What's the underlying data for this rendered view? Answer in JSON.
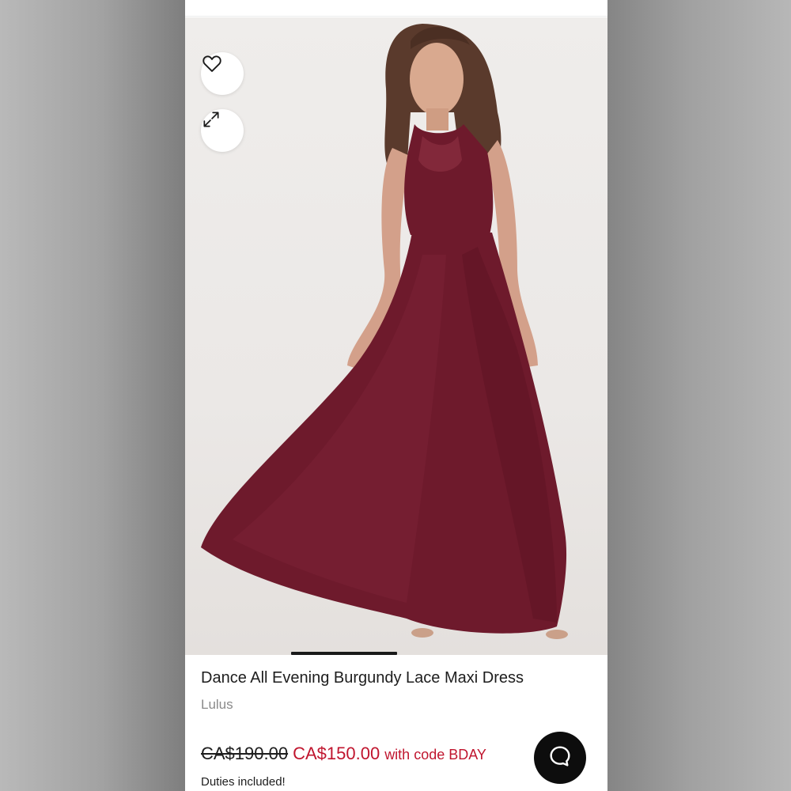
{
  "product": {
    "title": "Dance All Evening Burgundy Lace Maxi Dress",
    "brand": "Lulus",
    "original_price": "CA$190.00",
    "sale_price": "CA$150.00",
    "promo_text": "with code BDAY",
    "duties_text": "Duties included!"
  },
  "icons": {
    "like": "heart-icon",
    "expand": "expand-icon",
    "chat": "chat-bubble-icon"
  },
  "colors": {
    "sale": "#c0152e",
    "dress": "#6e1a2c",
    "image_background": "#ebe8e6"
  }
}
